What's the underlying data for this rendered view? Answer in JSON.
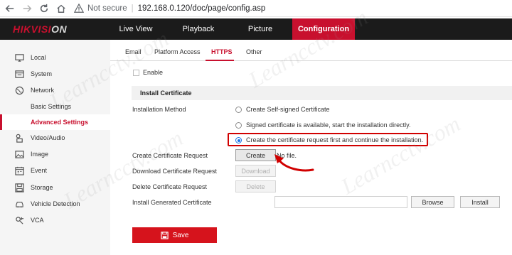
{
  "browser": {
    "security_label": "Not secure",
    "url": "192.168.0.120/doc/page/config.asp"
  },
  "app": {
    "logo_main": "HIKVISI",
    "logo_tail": "ON",
    "top_nav": [
      "Live View",
      "Playback",
      "Picture",
      "Configuration"
    ],
    "active_top_nav": "Configuration"
  },
  "sidebar": {
    "items": [
      {
        "label": "Local",
        "icon": "monitor-icon"
      },
      {
        "label": "System",
        "icon": "system-icon"
      },
      {
        "label": "Network",
        "icon": "globe-icon"
      },
      {
        "label": "Basic Settings",
        "icon": ""
      },
      {
        "label": "Advanced Settings",
        "icon": ""
      },
      {
        "label": "Video/Audio",
        "icon": "video-audio-icon"
      },
      {
        "label": "Image",
        "icon": "image-icon"
      },
      {
        "label": "Event",
        "icon": "calendar-icon"
      },
      {
        "label": "Storage",
        "icon": "storage-icon"
      },
      {
        "label": "Vehicle Detection",
        "icon": "vehicle-detection-icon"
      },
      {
        "label": "VCA",
        "icon": "vca-icon"
      }
    ],
    "active": "Advanced Settings"
  },
  "tabs": {
    "items": [
      "Email",
      "Platform Access",
      "HTTPS",
      "Other"
    ],
    "active": "HTTPS"
  },
  "form": {
    "enable_label": "Enable",
    "enable_checked": false,
    "section_title": "Install Certificate",
    "installation_method_label": "Installation Method",
    "options": [
      "Create Self-signed Certificate",
      "Signed certificate is available, start the installation directly.",
      "Create the certificate request first and continue the installation."
    ],
    "selected_option_index": 2,
    "create_request_label": "Create Certificate Request",
    "create_button": "Create",
    "no_file_text": "No file.",
    "download_request_label": "Download Certificate Request",
    "download_button": "Download",
    "delete_request_label": "Delete Certificate Request",
    "delete_button": "Delete",
    "install_generated_label": "Install Generated Certificate",
    "browse_button": "Browse",
    "install_button": "Install",
    "save_button": "Save"
  },
  "watermark": "Learncctv.com",
  "colors": {
    "brand_red": "#c8102e",
    "highlight_red": "#d10000",
    "save_red": "#d6131c",
    "radio_blue": "#1a73e8"
  }
}
